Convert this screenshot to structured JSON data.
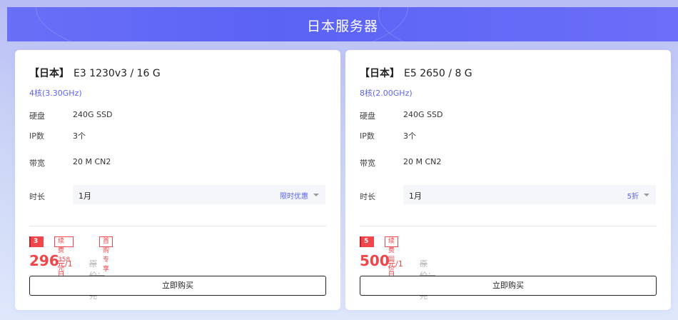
{
  "banner": {
    "title": "日本服务器"
  },
  "cards": [
    {
      "title_tag": "【日本】",
      "title_name": "E3 1230v3 / 16 G",
      "cores": "4核(3.30GHz)",
      "disk_label": "硬盘",
      "disk_value": "240G SSD",
      "ip_label": "IP数",
      "ip_value": "3个",
      "bw_label": "带宽",
      "bw_value": "20 M CN2",
      "duration_label": "时长",
      "duration_value": "1月",
      "duration_promo": "限时优惠",
      "discount_badge": "3 折",
      "tags": [
        "续费358元",
        "首购专享"
      ],
      "price": "296",
      "price_unit": "元/1月",
      "original_price": "原价：1000 元",
      "buy_label": "立即购买"
    },
    {
      "title_tag": "【日本】",
      "title_name": "E5 2650 / 8 G",
      "cores": "8核(2.00GHz)",
      "disk_label": "硬盘",
      "disk_value": "240G SSD",
      "ip_label": "IP数",
      "ip_value": "3个",
      "bw_label": "带宽",
      "bw_value": "20 M CN2",
      "duration_label": "时长",
      "duration_value": "1月",
      "duration_promo": "5折",
      "discount_badge": "5 折",
      "tags": [
        "续费同价"
      ],
      "price": "500",
      "price_unit": "元/1月",
      "original_price": "原价：1000 元",
      "buy_label": "立即购买"
    }
  ],
  "colors": {
    "accent": "#5b63f5",
    "price_red": "#f0454a"
  }
}
